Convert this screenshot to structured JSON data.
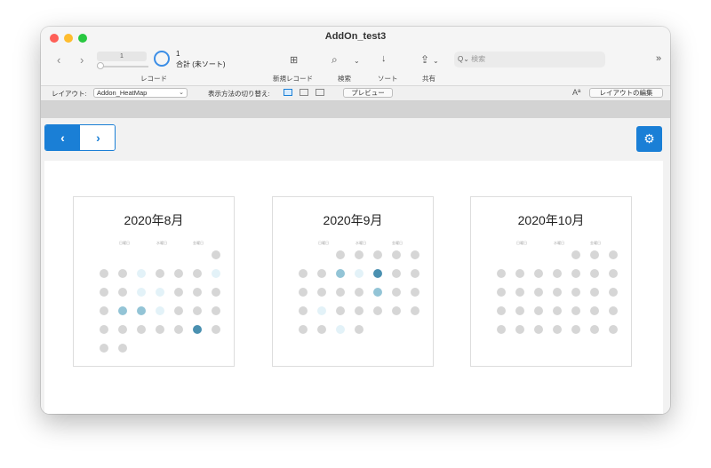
{
  "window": {
    "title": "AddOn_test3"
  },
  "toolbar": {
    "record_field_value": "1",
    "record_count": "1",
    "record_total": "合計 (未ソート)",
    "records_label": "レコード",
    "new_record_label": "新規レコード",
    "search_label": "検索",
    "sort_label": "ソート",
    "share_label": "共有",
    "search_placeholder": "検索",
    "icons": [
      "chevron-left-icon",
      "chevron-right-icon",
      "pie-icon",
      "plus-icon",
      "magnifier-icon",
      "sort-icon",
      "share-icon",
      "search-icon",
      "more-icon"
    ]
  },
  "layoutbar": {
    "layout_label": "レイアウト:",
    "layout_value": "Addon_HeatMap",
    "view_label": "表示方法の切り替え:",
    "preview_label": "プレビュー",
    "aa_label": "Aª",
    "edit_layout_label": "レイアウトの編集"
  },
  "colors": {
    "accent": "#1a7fd6",
    "empty": "#d6d6d6",
    "level1": "#e3f2f8",
    "level2": "#93c4d6",
    "level3": "#4a90b0"
  },
  "calendars": [
    {
      "title": "2020年8月",
      "dow": [
        "日曜日",
        "水曜日",
        "金曜日"
      ],
      "grid": [
        [
          null,
          null,
          null,
          null,
          null,
          null,
          0
        ],
        [
          0,
          0,
          1,
          0,
          0,
          0,
          1
        ],
        [
          0,
          0,
          1,
          1,
          0,
          0,
          0
        ],
        [
          0,
          2,
          2,
          1,
          0,
          0,
          0
        ],
        [
          0,
          0,
          0,
          0,
          0,
          3,
          0
        ],
        [
          0,
          0,
          null,
          null,
          null,
          null,
          null
        ]
      ]
    },
    {
      "title": "2020年9月",
      "dow": [
        "日曜日",
        "水曜日",
        "金曜日"
      ],
      "grid": [
        [
          null,
          null,
          0,
          0,
          0,
          0,
          0
        ],
        [
          0,
          0,
          2,
          1,
          3,
          0,
          0
        ],
        [
          0,
          0,
          0,
          0,
          2,
          0,
          0
        ],
        [
          0,
          1,
          0,
          0,
          0,
          0,
          0
        ],
        [
          0,
          0,
          1,
          0,
          null,
          null,
          null
        ]
      ]
    },
    {
      "title": "2020年10月",
      "dow": [
        "日曜日",
        "水曜日",
        "金曜日"
      ],
      "grid": [
        [
          null,
          null,
          null,
          null,
          0,
          0,
          0
        ],
        [
          0,
          0,
          0,
          0,
          0,
          0,
          0
        ],
        [
          0,
          0,
          0,
          0,
          0,
          0,
          0
        ],
        [
          0,
          0,
          0,
          0,
          0,
          0,
          0
        ],
        [
          0,
          0,
          0,
          0,
          0,
          0,
          0
        ]
      ]
    }
  ]
}
